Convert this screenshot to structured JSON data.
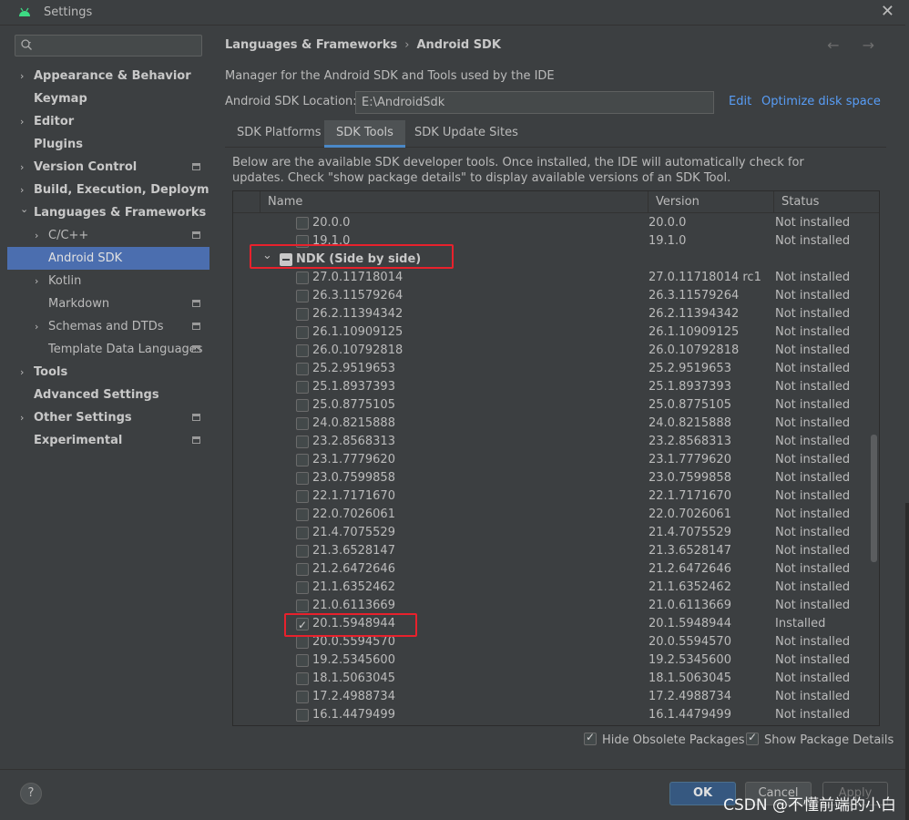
{
  "window": {
    "title": "Settings",
    "close_glyph": "✕"
  },
  "search": {
    "placeholder": ""
  },
  "sidebar": {
    "items": [
      {
        "label": "Appearance & Behavior",
        "arrow": "›",
        "level": 0,
        "bold": true,
        "proj": false
      },
      {
        "label": "Keymap",
        "arrow": "",
        "level": 0,
        "bold": true,
        "proj": false
      },
      {
        "label": "Editor",
        "arrow": "›",
        "level": 0,
        "bold": true,
        "proj": false
      },
      {
        "label": "Plugins",
        "arrow": "",
        "level": 0,
        "bold": true,
        "proj": false
      },
      {
        "label": "Version Control",
        "arrow": "›",
        "level": 0,
        "bold": true,
        "proj": true
      },
      {
        "label": "Build, Execution, Deployment",
        "arrow": "›",
        "level": 0,
        "bold": true,
        "proj": false
      },
      {
        "label": "Languages & Frameworks",
        "arrow": "⌄",
        "level": 0,
        "bold": true,
        "proj": false
      },
      {
        "label": "C/C++",
        "arrow": "›",
        "level": 1,
        "bold": false,
        "proj": true
      },
      {
        "label": "Android SDK",
        "arrow": "",
        "level": 1,
        "bold": false,
        "proj": false,
        "selected": true
      },
      {
        "label": "Kotlin",
        "arrow": "›",
        "level": 1,
        "bold": false,
        "proj": false
      },
      {
        "label": "Markdown",
        "arrow": "",
        "level": 1,
        "bold": false,
        "proj": true
      },
      {
        "label": "Schemas and DTDs",
        "arrow": "›",
        "level": 1,
        "bold": false,
        "proj": true
      },
      {
        "label": "Template Data Languages",
        "arrow": "",
        "level": 1,
        "bold": false,
        "proj": true
      },
      {
        "label": "Tools",
        "arrow": "›",
        "level": 0,
        "bold": true,
        "proj": false
      },
      {
        "label": "Advanced Settings",
        "arrow": "",
        "level": 0,
        "bold": true,
        "proj": false
      },
      {
        "label": "Other Settings",
        "arrow": "›",
        "level": 0,
        "bold": true,
        "proj": true
      },
      {
        "label": "Experimental",
        "arrow": "",
        "level": 0,
        "bold": true,
        "proj": true
      }
    ]
  },
  "breadcrumb": {
    "parent": "Languages & Frameworks",
    "sep": "›",
    "current": "Android SDK",
    "nav": "← →"
  },
  "main": {
    "description": "Manager for the Android SDK and Tools used by the IDE",
    "location_label": "Android SDK Location:",
    "location_value": "E:\\AndroidSdk",
    "edit_link": "Edit",
    "optimize_link": "Optimize disk space",
    "tabs": [
      "SDK Platforms",
      "SDK Tools",
      "SDK Update Sites"
    ],
    "tools_description": "Below are the available SDK developer tools. Once installed, the IDE will automatically check for updates. Check \"show package details\" to display available versions of an SDK Tool."
  },
  "table": {
    "columns": [
      "Name",
      "Version",
      "Status"
    ],
    "rows": [
      {
        "type": "item",
        "name": "20.0.0",
        "version": "20.0.0",
        "status": "Not installed",
        "checked": false
      },
      {
        "type": "item",
        "name": "19.1.0",
        "version": "19.1.0",
        "status": "Not installed",
        "checked": false
      },
      {
        "type": "group",
        "name": "NDK (Side by side)",
        "version": "",
        "status": ""
      },
      {
        "type": "item",
        "name": "27.0.11718014",
        "version": "27.0.11718014 rc1",
        "status": "Not installed",
        "checked": false
      },
      {
        "type": "item",
        "name": "26.3.11579264",
        "version": "26.3.11579264",
        "status": "Not installed",
        "checked": false
      },
      {
        "type": "item",
        "name": "26.2.11394342",
        "version": "26.2.11394342",
        "status": "Not installed",
        "checked": false
      },
      {
        "type": "item",
        "name": "26.1.10909125",
        "version": "26.1.10909125",
        "status": "Not installed",
        "checked": false
      },
      {
        "type": "item",
        "name": "26.0.10792818",
        "version": "26.0.10792818",
        "status": "Not installed",
        "checked": false
      },
      {
        "type": "item",
        "name": "25.2.9519653",
        "version": "25.2.9519653",
        "status": "Not installed",
        "checked": false
      },
      {
        "type": "item",
        "name": "25.1.8937393",
        "version": "25.1.8937393",
        "status": "Not installed",
        "checked": false
      },
      {
        "type": "item",
        "name": "25.0.8775105",
        "version": "25.0.8775105",
        "status": "Not installed",
        "checked": false
      },
      {
        "type": "item",
        "name": "24.0.8215888",
        "version": "24.0.8215888",
        "status": "Not installed",
        "checked": false
      },
      {
        "type": "item",
        "name": "23.2.8568313",
        "version": "23.2.8568313",
        "status": "Not installed",
        "checked": false
      },
      {
        "type": "item",
        "name": "23.1.7779620",
        "version": "23.1.7779620",
        "status": "Not installed",
        "checked": false
      },
      {
        "type": "item",
        "name": "23.0.7599858",
        "version": "23.0.7599858",
        "status": "Not installed",
        "checked": false
      },
      {
        "type": "item",
        "name": "22.1.7171670",
        "version": "22.1.7171670",
        "status": "Not installed",
        "checked": false
      },
      {
        "type": "item",
        "name": "22.0.7026061",
        "version": "22.0.7026061",
        "status": "Not installed",
        "checked": false
      },
      {
        "type": "item",
        "name": "21.4.7075529",
        "version": "21.4.7075529",
        "status": "Not installed",
        "checked": false
      },
      {
        "type": "item",
        "name": "21.3.6528147",
        "version": "21.3.6528147",
        "status": "Not installed",
        "checked": false
      },
      {
        "type": "item",
        "name": "21.2.6472646",
        "version": "21.2.6472646",
        "status": "Not installed",
        "checked": false
      },
      {
        "type": "item",
        "name": "21.1.6352462",
        "version": "21.1.6352462",
        "status": "Not installed",
        "checked": false
      },
      {
        "type": "item",
        "name": "21.0.6113669",
        "version": "21.0.6113669",
        "status": "Not installed",
        "checked": false
      },
      {
        "type": "item",
        "name": "20.1.5948944",
        "version": "20.1.5948944",
        "status": "Installed",
        "checked": true
      },
      {
        "type": "item",
        "name": "20.0.5594570",
        "version": "20.0.5594570",
        "status": "Not installed",
        "checked": false
      },
      {
        "type": "item",
        "name": "19.2.5345600",
        "version": "19.2.5345600",
        "status": "Not installed",
        "checked": false
      },
      {
        "type": "item",
        "name": "18.1.5063045",
        "version": "18.1.5063045",
        "status": "Not installed",
        "checked": false
      },
      {
        "type": "item",
        "name": "17.2.4988734",
        "version": "17.2.4988734",
        "status": "Not installed",
        "checked": false
      },
      {
        "type": "item",
        "name": "16.1.4479499",
        "version": "16.1.4479499",
        "status": "Not installed",
        "checked": false
      }
    ]
  },
  "options": {
    "hide_obsolete": {
      "label": "Hide Obsolete Packages",
      "checked": true
    },
    "show_details": {
      "label": "Show Package Details",
      "checked": true
    }
  },
  "footer": {
    "help": "?",
    "ok": "OK",
    "cancel": "Cancel",
    "apply": "Apply"
  },
  "watermark": "CSDN @不懂前端的小白",
  "colors": {
    "accent": "#4b6eaf",
    "link": "#589df6",
    "highlight_box": "#e8212c",
    "ok_button": "#365880"
  }
}
